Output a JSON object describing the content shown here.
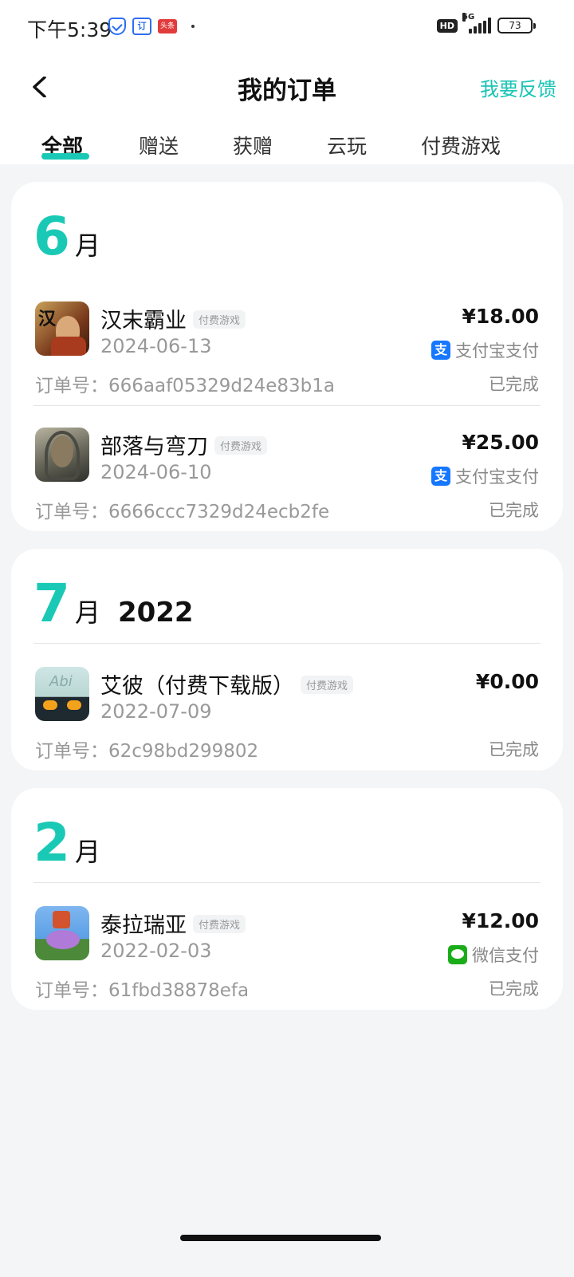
{
  "status_bar": {
    "time": "下午5:39",
    "app_badge": "头条",
    "app_small": "订",
    "hd": "HD",
    "network": "5G",
    "battery": "73"
  },
  "header": {
    "title": "我的订单",
    "feedback_label": "我要反馈"
  },
  "tabs": [
    {
      "label": "全部",
      "active": true
    },
    {
      "label": "赠送",
      "active": false
    },
    {
      "label": "获赠",
      "active": false
    },
    {
      "label": "云玩",
      "active": false
    },
    {
      "label": "付费游戏",
      "active": false
    }
  ],
  "groups": [
    {
      "month": "6",
      "unit": "月",
      "year": "",
      "orders": [
        {
          "name": "汉末霸业",
          "tag": "付费游戏",
          "date": "2024-06-13",
          "order_no_label": "订单号：",
          "order_no": "666aaf05329d24e83b1a",
          "price": "¥18.00",
          "pay_method": "支付宝支付",
          "pay_icon": "alipay-icon",
          "pay_icon_glyph": "支",
          "status": "已完成",
          "icon_glyph": "汉"
        },
        {
          "name": "部落与弯刀",
          "tag": "付费游戏",
          "date": "2024-06-10",
          "order_no_label": "订单号：",
          "order_no": "6666ccc7329d24ecb2fe",
          "price": "¥25.00",
          "pay_method": "支付宝支付",
          "pay_icon": "alipay-icon",
          "pay_icon_glyph": "支",
          "status": "已完成",
          "icon_glyph": ""
        }
      ]
    },
    {
      "month": "7",
      "unit": "月",
      "year": "2022",
      "orders": [
        {
          "name": "艾彼（付费下载版）",
          "tag": "付费游戏",
          "date": "2022-07-09",
          "order_no_label": "订单号：",
          "order_no": "62c98bd299802",
          "price": "¥0.00",
          "pay_method": "",
          "pay_icon": "",
          "status": "已完成",
          "icon_glyph": "Abi"
        }
      ]
    },
    {
      "month": "2",
      "unit": "月",
      "year": "",
      "orders": [
        {
          "name": "泰拉瑞亚",
          "tag": "付费游戏",
          "date": "2022-02-03",
          "order_no_label": "订单号：",
          "order_no": "61fbd38878efa",
          "price": "¥12.00",
          "pay_method": "微信支付",
          "pay_icon": "wechat-pay-icon",
          "status": "已完成",
          "icon_glyph": ""
        }
      ]
    }
  ],
  "colors": {
    "accent": "#1ac9b5",
    "alipay": "#1677ff",
    "wechat": "#1aad19"
  }
}
